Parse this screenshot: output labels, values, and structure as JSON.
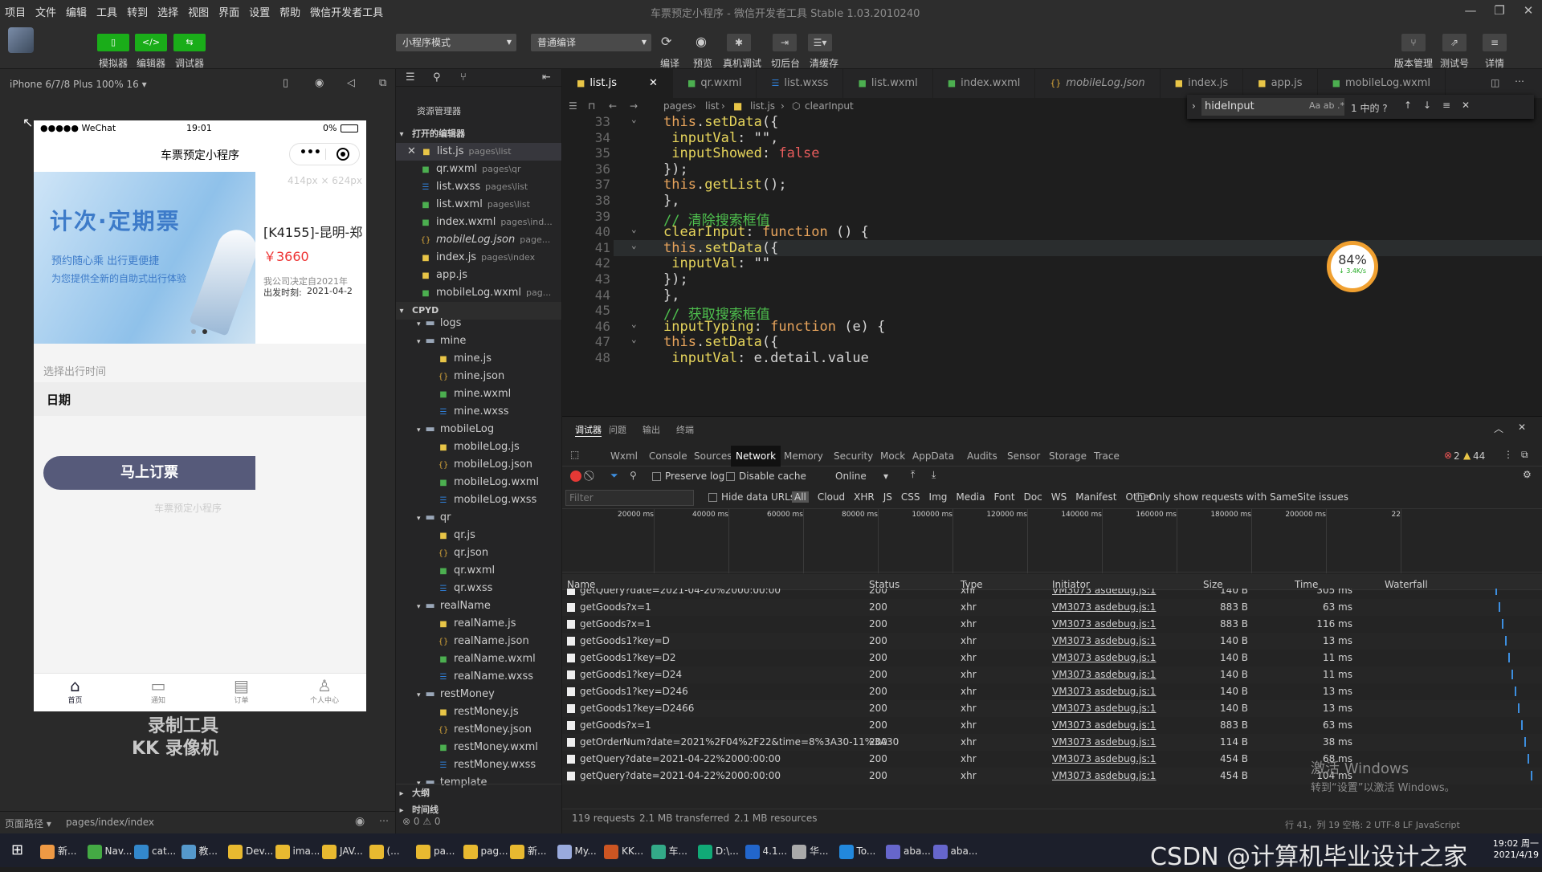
{
  "menubar": {
    "items": [
      "项目",
      "文件",
      "编辑",
      "工具",
      "转到",
      "选择",
      "视图",
      "界面",
      "设置",
      "帮助",
      "微信开发者工具"
    ],
    "title": "车票预定小程序 - 微信开发者工具 Stable 1.03.2010240"
  },
  "toolbar": {
    "left": [
      {
        "label": "模拟器",
        "glyph": "▯"
      },
      {
        "label": "编辑器",
        "glyph": "</>"
      },
      {
        "label": "调试器",
        "glyph": "⇆"
      }
    ],
    "mode": "小程序模式",
    "compile": "普通编译",
    "actions": [
      "编译",
      "预览",
      "真机调试",
      "切后台",
      "清缓存"
    ],
    "right": [
      "版本管理",
      "测试号",
      "详情"
    ]
  },
  "simulator": {
    "device": "iPhone 6/7/8 Plus 100% 16 ▾",
    "size_hint": "414px × 624px",
    "status_carrier": "●●●●● WeChat",
    "status_time": "19:01",
    "status_battery": "0%",
    "nav_title": "车票预定小程序",
    "nav_more": "•••",
    "banner_title": "计次·定期票",
    "banner_sub1": "预约随心乘 出行更便捷",
    "banner_sub2": "为您提供全新的自助式出行体验",
    "ticket_title": "[K4155]-昆明-郑",
    "ticket_price": "￥3660",
    "ticket_note1": "我公司决定自2021年",
    "ticket_note2_label": "出发时刻:",
    "ticket_note2_value": "2021-04-2",
    "date_section": "选择出行时间",
    "date_label": "日期",
    "book_button": "马上订票",
    "footer_text": "车票预定小程序",
    "tabs": [
      {
        "label": "首页",
        "icon": "home-icon"
      },
      {
        "label": "通知",
        "icon": "book-icon"
      },
      {
        "label": "订单",
        "icon": "order-icon"
      },
      {
        "label": "个人中心",
        "icon": "user-icon"
      }
    ],
    "watermark1": "录制工具",
    "watermark2": "KK 录像机",
    "page_path_label": "页面路径 ▾",
    "page_path": "pages/index/index",
    "errors": "⊗ 0 ⚠ 0"
  },
  "explorer": {
    "title": "资源管理器",
    "open_section": "打开的编辑器",
    "project": "CPYD",
    "open_files": [
      {
        "name": "list.js",
        "path": "pages\\list",
        "type": "js"
      },
      {
        "name": "qr.wxml",
        "path": "pages\\qr",
        "type": "wxml"
      },
      {
        "name": "list.wxss",
        "path": "pages\\list",
        "type": "wxss"
      },
      {
        "name": "list.wxml",
        "path": "pages\\list",
        "type": "wxml"
      },
      {
        "name": "index.wxml",
        "path": "pages\\ind...",
        "type": "wxml"
      },
      {
        "name": "mobileLog.json",
        "path": "page...",
        "type": "json"
      },
      {
        "name": "index.js",
        "path": "pages\\index",
        "type": "js"
      },
      {
        "name": "app.js",
        "path": "",
        "type": "js"
      },
      {
        "name": "mobileLog.wxml",
        "path": "pag...",
        "type": "wxml"
      }
    ],
    "tree": [
      {
        "name": "logs",
        "type": "folder",
        "depth": 1
      },
      {
        "name": "mine",
        "type": "folder",
        "depth": 1
      },
      {
        "name": "mine.js",
        "type": "js",
        "depth": 2
      },
      {
        "name": "mine.json",
        "type": "json",
        "depth": 2
      },
      {
        "name": "mine.wxml",
        "type": "wxml",
        "depth": 2
      },
      {
        "name": "mine.wxss",
        "type": "wxss",
        "depth": 2
      },
      {
        "name": "mobileLog",
        "type": "folder",
        "depth": 1
      },
      {
        "name": "mobileLog.js",
        "type": "js",
        "depth": 2
      },
      {
        "name": "mobileLog.json",
        "type": "json",
        "depth": 2
      },
      {
        "name": "mobileLog.wxml",
        "type": "wxml",
        "depth": 2
      },
      {
        "name": "mobileLog.wxss",
        "type": "wxss",
        "depth": 2
      },
      {
        "name": "qr",
        "type": "folder",
        "depth": 1
      },
      {
        "name": "qr.js",
        "type": "js",
        "depth": 2
      },
      {
        "name": "qr.json",
        "type": "json",
        "depth": 2
      },
      {
        "name": "qr.wxml",
        "type": "wxml",
        "depth": 2
      },
      {
        "name": "qr.wxss",
        "type": "wxss",
        "depth": 2
      },
      {
        "name": "realName",
        "type": "folder",
        "depth": 1
      },
      {
        "name": "realName.js",
        "type": "js",
        "depth": 2
      },
      {
        "name": "realName.json",
        "type": "json",
        "depth": 2
      },
      {
        "name": "realName.wxml",
        "type": "wxml",
        "depth": 2
      },
      {
        "name": "realName.wxss",
        "type": "wxss",
        "depth": 2
      },
      {
        "name": "restMoney",
        "type": "folder",
        "depth": 1
      },
      {
        "name": "restMoney.js",
        "type": "js",
        "depth": 2
      },
      {
        "name": "restMoney.json",
        "type": "json",
        "depth": 2
      },
      {
        "name": "restMoney.wxml",
        "type": "wxml",
        "depth": 2
      },
      {
        "name": "restMoney.wxss",
        "type": "wxss",
        "depth": 2
      },
      {
        "name": "template",
        "type": "folder",
        "depth": 1
      }
    ],
    "outline": "大纲",
    "timeline": "时间线"
  },
  "editor": {
    "tabs": [
      {
        "label": "list.js",
        "type": "js",
        "active": true
      },
      {
        "label": "qr.wxml",
        "type": "wxml"
      },
      {
        "label": "list.wxss",
        "type": "wxss"
      },
      {
        "label": "list.wxml",
        "type": "wxml"
      },
      {
        "label": "index.wxml",
        "type": "wxml"
      },
      {
        "label": "mobileLog.json",
        "type": "json"
      },
      {
        "label": "index.js",
        "type": "js"
      },
      {
        "label": "app.js",
        "type": "js"
      },
      {
        "label": "mobileLog.wxml",
        "type": "wxml"
      }
    ],
    "breadcrumb": [
      "pages",
      "list",
      "list.js",
      "clearInput"
    ],
    "find": {
      "value": "hideInput",
      "result": "1 中的 ?"
    },
    "perf_percent": "84%",
    "perf_rate": "↓ 3.4K/s",
    "lines": [
      {
        "n": "33",
        "code": "this.setData({"
      },
      {
        "n": "34",
        "code": " inputVal: \"\","
      },
      {
        "n": "35",
        "code": " inputShowed: false"
      },
      {
        "n": "36",
        "code": "});"
      },
      {
        "n": "37",
        "code": "this.getList();"
      },
      {
        "n": "38",
        "code": "},"
      },
      {
        "n": "39",
        "code": "// 清除搜索框值"
      },
      {
        "n": "40",
        "code": "clearInput: function () {"
      },
      {
        "n": "41",
        "code": "this.setData({"
      },
      {
        "n": "42",
        "code": " inputVal: \"\""
      },
      {
        "n": "43",
        "code": "});"
      },
      {
        "n": "44",
        "code": "},"
      },
      {
        "n": "45",
        "code": "// 获取搜索框值"
      },
      {
        "n": "46",
        "code": "inputTyping: function (e) {"
      },
      {
        "n": "47",
        "code": "this.setData({"
      },
      {
        "n": "48",
        "code": " inputVal: e.detail.value"
      }
    ]
  },
  "devtools": {
    "top_tabs": [
      "调试器",
      "问题",
      "输出",
      "终端"
    ],
    "panels": [
      "Wxml",
      "Console",
      "Sources",
      "Network",
      "Memory",
      "Security",
      "Mock",
      "AppData",
      "Audits",
      "Sensor",
      "Storage",
      "Trace"
    ],
    "active_panel": "Network",
    "errors": "2",
    "warnings": "44",
    "preserve_log": "Preserve log",
    "disable_cache": "Disable cache",
    "throttle": "Online",
    "filter_placeholder": "Filter",
    "hide_data_urls": "Hide data URLs",
    "types": [
      "All",
      "Cloud",
      "XHR",
      "JS",
      "CSS",
      "Img",
      "Media",
      "Font",
      "Doc",
      "WS",
      "Manifest",
      "Other"
    ],
    "same_site": "Only show requests with SameSite issues",
    "timeline_ticks": [
      "20000 ms",
      "40000 ms",
      "60000 ms",
      "80000 ms",
      "100000 ms",
      "120000 ms",
      "140000 ms",
      "160000 ms",
      "180000 ms",
      "200000 ms",
      "22"
    ],
    "columns": [
      "Name",
      "Status",
      "Type",
      "Initiator",
      "Size",
      "Time",
      "Waterfall"
    ],
    "requests": [
      {
        "name": "getQuery?date=2021-04-20%2000:00:00",
        "status": "200",
        "type": "xhr",
        "initiator": "VM3073 asdebug.js:1",
        "size": "140 B",
        "time": "305 ms"
      },
      {
        "name": "getGoods?x=1",
        "status": "200",
        "type": "xhr",
        "initiator": "VM3073 asdebug.js:1",
        "size": "883 B",
        "time": "63 ms"
      },
      {
        "name": "getGoods?x=1",
        "status": "200",
        "type": "xhr",
        "initiator": "VM3073 asdebug.js:1",
        "size": "883 B",
        "time": "116 ms"
      },
      {
        "name": "getGoods1?key=D",
        "status": "200",
        "type": "xhr",
        "initiator": "VM3073 asdebug.js:1",
        "size": "140 B",
        "time": "13 ms"
      },
      {
        "name": "getGoods1?key=D2",
        "status": "200",
        "type": "xhr",
        "initiator": "VM3073 asdebug.js:1",
        "size": "140 B",
        "time": "11 ms"
      },
      {
        "name": "getGoods1?key=D24",
        "status": "200",
        "type": "xhr",
        "initiator": "VM3073 asdebug.js:1",
        "size": "140 B",
        "time": "11 ms"
      },
      {
        "name": "getGoods1?key=D246",
        "status": "200",
        "type": "xhr",
        "initiator": "VM3073 asdebug.js:1",
        "size": "140 B",
        "time": "13 ms"
      },
      {
        "name": "getGoods1?key=D2466",
        "status": "200",
        "type": "xhr",
        "initiator": "VM3073 asdebug.js:1",
        "size": "140 B",
        "time": "13 ms"
      },
      {
        "name": "getGoods?x=1",
        "status": "200",
        "type": "xhr",
        "initiator": "VM3073 asdebug.js:1",
        "size": "883 B",
        "time": "63 ms"
      },
      {
        "name": "getOrderNum?date=2021%2F04%2F22&time=8%3A30-11%3A30",
        "status": "200",
        "type": "xhr",
        "initiator": "VM3073 asdebug.js:1",
        "size": "114 B",
        "time": "38 ms"
      },
      {
        "name": "getQuery?date=2021-04-22%2000:00:00",
        "status": "200",
        "type": "xhr",
        "initiator": "VM3073 asdebug.js:1",
        "size": "454 B",
        "time": "68 ms"
      },
      {
        "name": "getQuery?date=2021-04-22%2000:00:00",
        "status": "200",
        "type": "xhr",
        "initiator": "VM3073 asdebug.js:1",
        "size": "454 B",
        "time": "104 ms"
      }
    ],
    "summary": {
      "requests": "119 requests",
      "transferred": "2.1 MB transferred",
      "resources": "2.1 MB resources"
    },
    "activate_windows": "激活 Windows",
    "activate_sub": "转到“设置”以激活 Windows。",
    "statusbar": "行 41，列 19  空格: 2  UTF-8  LF  JavaScript"
  },
  "taskbar": {
    "items": [
      "新...",
      "Nav...",
      "cat...",
      "教...",
      "Dev...",
      "ima...",
      "JAV...",
      "(...",
      "pa...",
      "pag...",
      "新...",
      "My...",
      "KK...",
      "车...",
      "D:\\...",
      "4.1...",
      "华...",
      "To...",
      "aba...",
      "aba..."
    ],
    "watermark": "CSDN @计算机毕业设计之家",
    "clock_time": "19:02 周一",
    "clock_date": "2021/4/19"
  },
  "colors": {
    "green": "#1aad19",
    "accent_tab": "#0e639c",
    "book_button": "#565a7a",
    "js": "#e8c547",
    "wxml": "#4caf50",
    "wxss": "#2f7fd8",
    "json": "#d6a53a"
  }
}
